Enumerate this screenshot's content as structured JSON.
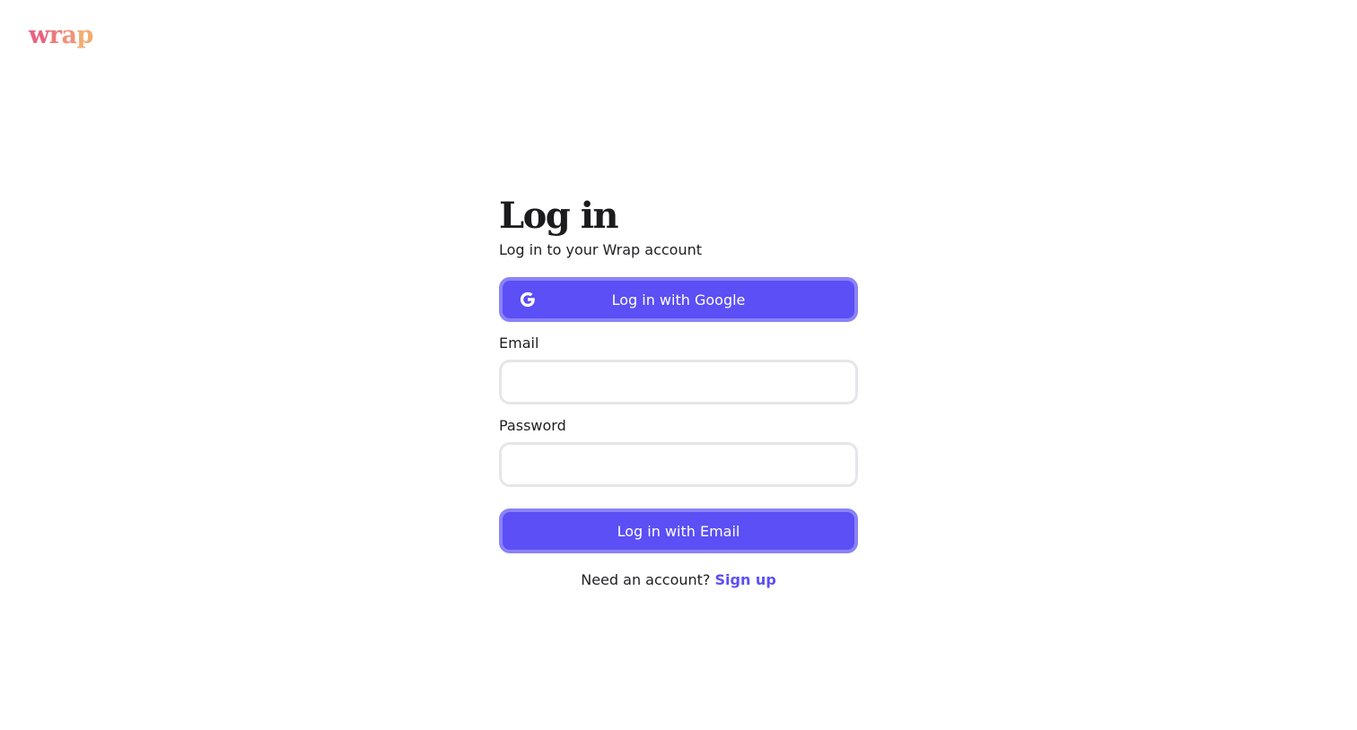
{
  "brand": {
    "logo_parts": [
      "w",
      "r",
      "a",
      "p"
    ],
    "colors": [
      "#e8637f",
      "#ec7a7a",
      "#f0927a",
      "#f2ac72"
    ]
  },
  "login": {
    "title": "Log in",
    "subtitle": "Log in to your Wrap account",
    "google_button_label": "Log in with Google",
    "google_icon": "google-icon",
    "email_label": "Email",
    "email_value": "",
    "email_placeholder": "",
    "password_label": "Password",
    "password_value": "",
    "password_placeholder": "",
    "email_button_label": "Log in with Email",
    "signup_prompt": "Need an account?",
    "signup_link": "Sign up"
  },
  "colors": {
    "accent": "#5b4ff5",
    "accent_border": "#8a82f8",
    "input_border": "#e6e6ea"
  }
}
